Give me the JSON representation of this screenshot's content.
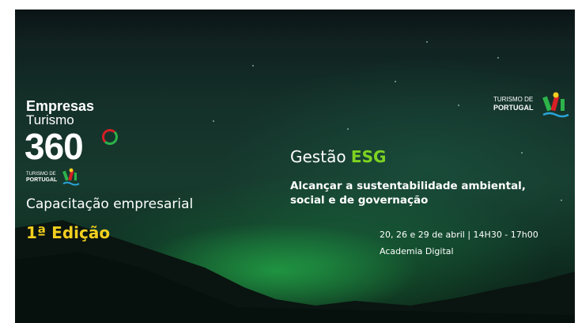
{
  "banner": {
    "brand": {
      "line1": "Empresas",
      "line2": "Turismo",
      "line3": "360"
    },
    "small_logo": {
      "line1": "TURISMO DE",
      "line2": "PORTUGAL"
    },
    "subtitle": "Capacitação empresarial",
    "edition": "1ª Edição",
    "right_logo": {
      "line1": "TURISMO DE",
      "line2": "PORTUGAL"
    },
    "course": {
      "title_prefix": "Gestão",
      "title_highlight": "ESG",
      "description": "Alcançar a sustentabilidade ambiental, social e de governação",
      "dates": "20, 26 e 29 de abril | 14H30 - 17h00",
      "place": "Academia Digital"
    },
    "colors": {
      "highlight_green": "#7ed321",
      "edition_yellow": "#f2cf1f",
      "logo_red": "#d61f26",
      "logo_green": "#2db34a"
    }
  }
}
